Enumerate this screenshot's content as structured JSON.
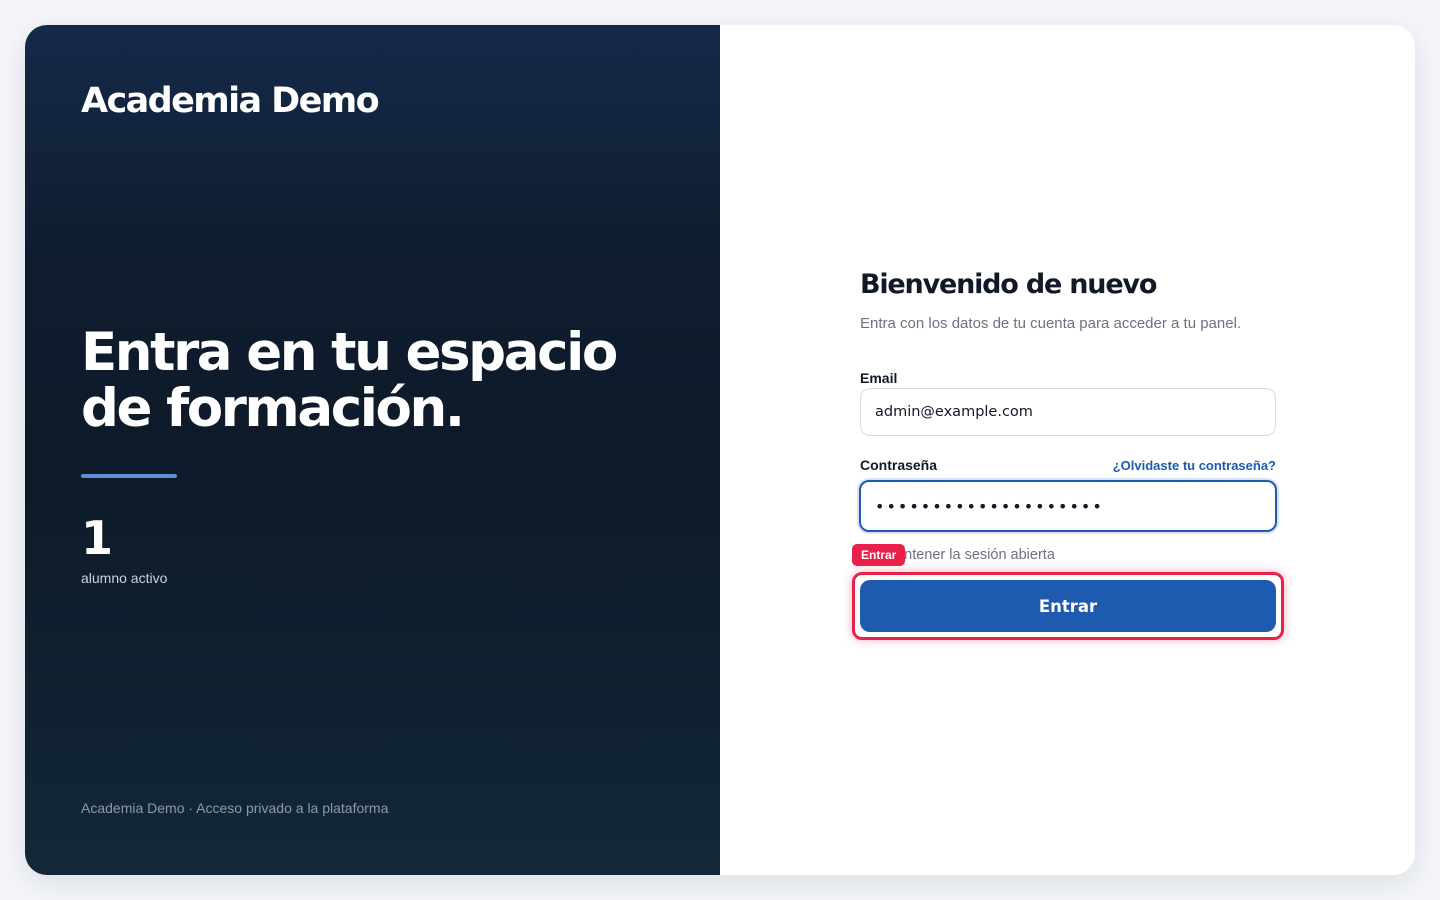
{
  "hero": {
    "brand": "Academia Demo",
    "headline": "Entra en tu espacio de formación.",
    "stat": {
      "value": "1",
      "label": "alumno activo"
    },
    "footer": "Academia Demo · Acceso privado a la plataforma"
  },
  "form": {
    "title": "Bienvenido de nuevo",
    "subtitle": "Entra con los datos de tu cuenta para acceder a tu panel.",
    "email": {
      "label": "Email",
      "value": "admin@example.com"
    },
    "password": {
      "label": "Contraseña",
      "value": "••••••••••••••••••••",
      "forgot_label": "¿Olvidaste tu contraseña?"
    },
    "remember_label": "Mantener la sesión abierta",
    "submit_label": "Entrar"
  },
  "annotation": {
    "tag": "Entrar"
  },
  "colors": {
    "accent": "#1e5bb0",
    "hero_background": "#0f1c2e",
    "annotation": "#e8204a"
  }
}
